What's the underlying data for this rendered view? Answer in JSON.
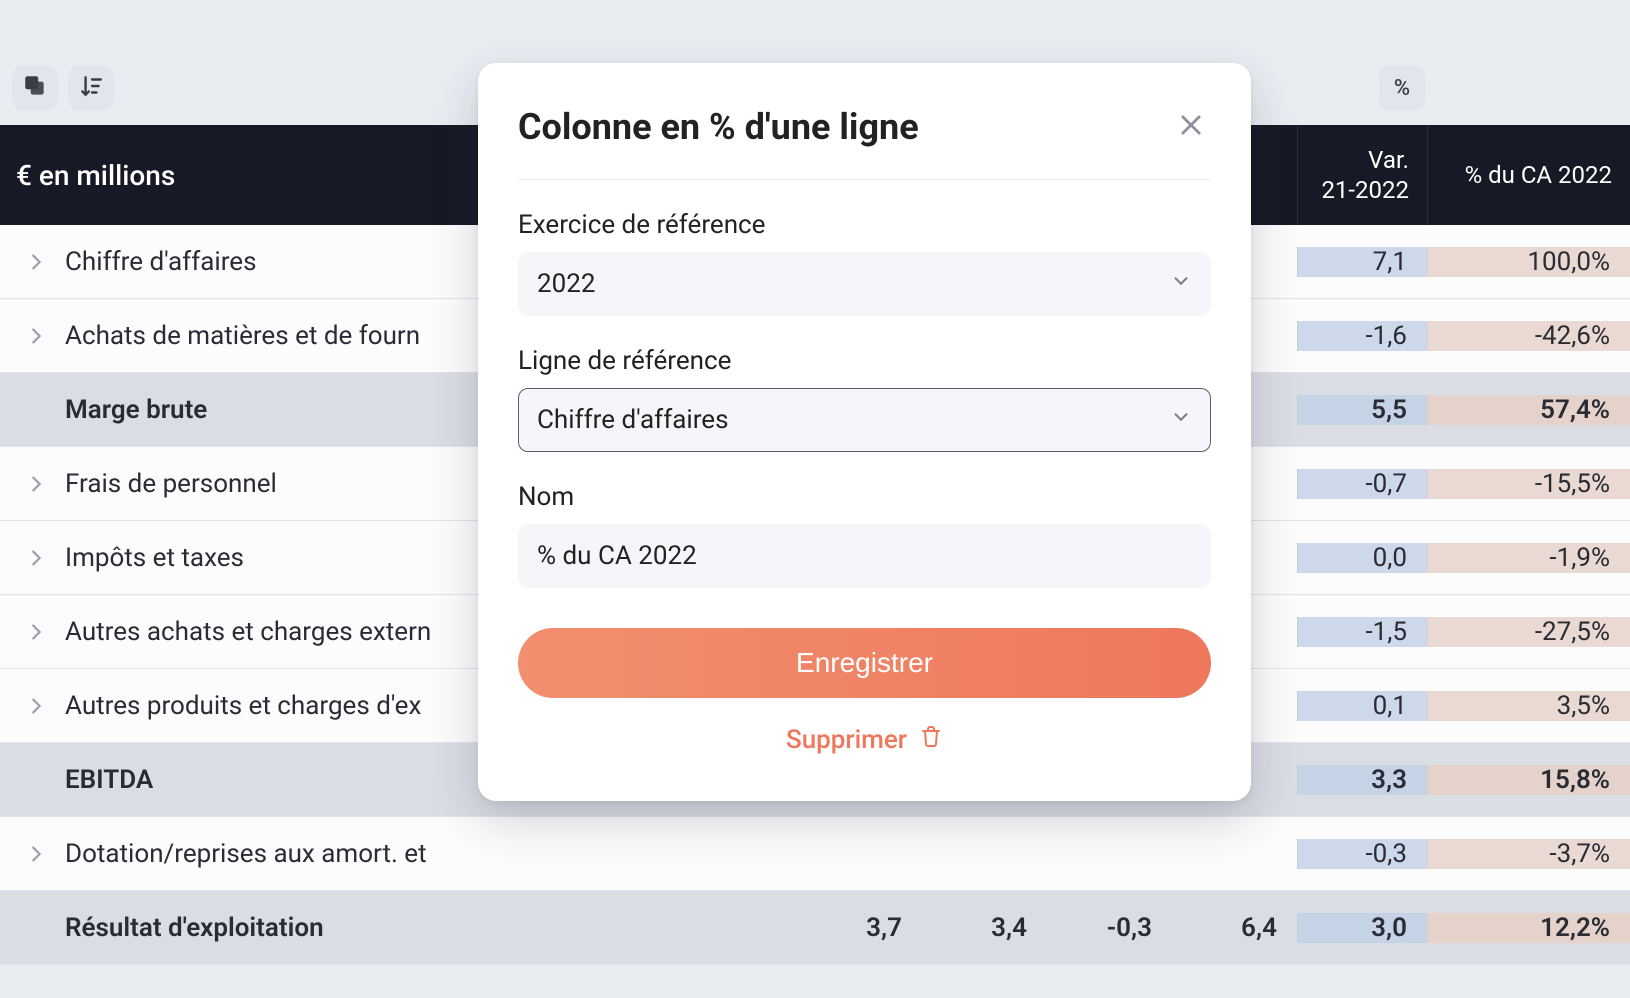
{
  "toolbar": {
    "percent_symbol": "%"
  },
  "table": {
    "header": {
      "label": "€ en millions",
      "var_col": "Var.\n21-2022",
      "ratio_col": "% du CA 2022"
    },
    "rows": [
      {
        "label": "Chiffre d'affaires",
        "subtotal": false,
        "c1": "",
        "c2": "",
        "c3": "",
        "c4": "",
        "var": "7,1",
        "ratio": "100,0%"
      },
      {
        "label": "Achats de matières et de fourn",
        "subtotal": false,
        "c1": "",
        "c2": "",
        "c3": "",
        "c4": "",
        "var": "-1,6",
        "ratio": "-42,6%"
      },
      {
        "label": "Marge brute",
        "subtotal": true,
        "c1": "",
        "c2": "",
        "c3": "",
        "c4": "",
        "var": "5,5",
        "ratio": "57,4%"
      },
      {
        "label": "Frais de personnel",
        "subtotal": false,
        "c1": "",
        "c2": "",
        "c3": "",
        "c4": "",
        "var": "-0,7",
        "ratio": "-15,5%"
      },
      {
        "label": "Impôts et taxes",
        "subtotal": false,
        "c1": "",
        "c2": "",
        "c3": "",
        "c4": "",
        "var": "0,0",
        "ratio": "-1,9%"
      },
      {
        "label": "Autres achats et charges extern",
        "subtotal": false,
        "c1": "",
        "c2": "",
        "c3": "",
        "c4": "",
        "var": "-1,5",
        "ratio": "-27,5%"
      },
      {
        "label": "Autres produits et charges d'ex",
        "subtotal": false,
        "c1": "",
        "c2": "",
        "c3": "",
        "c4": "",
        "var": "0,1",
        "ratio": "3,5%"
      },
      {
        "label": "EBITDA",
        "subtotal": true,
        "c1": "",
        "c2": "",
        "c3": "",
        "c4": "",
        "var": "3,3",
        "ratio": "15,8%"
      },
      {
        "label": "Dotation/reprises aux amort. et",
        "subtotal": false,
        "c1": "",
        "c2": "",
        "c3": "",
        "c4": "",
        "var": "-0,3",
        "ratio": "-3,7%"
      },
      {
        "label": "Résultat d'exploitation",
        "subtotal": true,
        "c1": "3,7",
        "c2": "3,4",
        "c3": "-0,3",
        "c4": "6,4",
        "var": "3,0",
        "ratio": "12,2%"
      }
    ]
  },
  "modal": {
    "title": "Colonne en % d'une ligne",
    "year_label": "Exercice de référence",
    "year_value": "2022",
    "line_label": "Ligne de référence",
    "line_value": "Chiffre d'affaires",
    "name_label": "Nom",
    "name_value": "% du CA 2022",
    "save": "Enregistrer",
    "delete": "Supprimer"
  }
}
